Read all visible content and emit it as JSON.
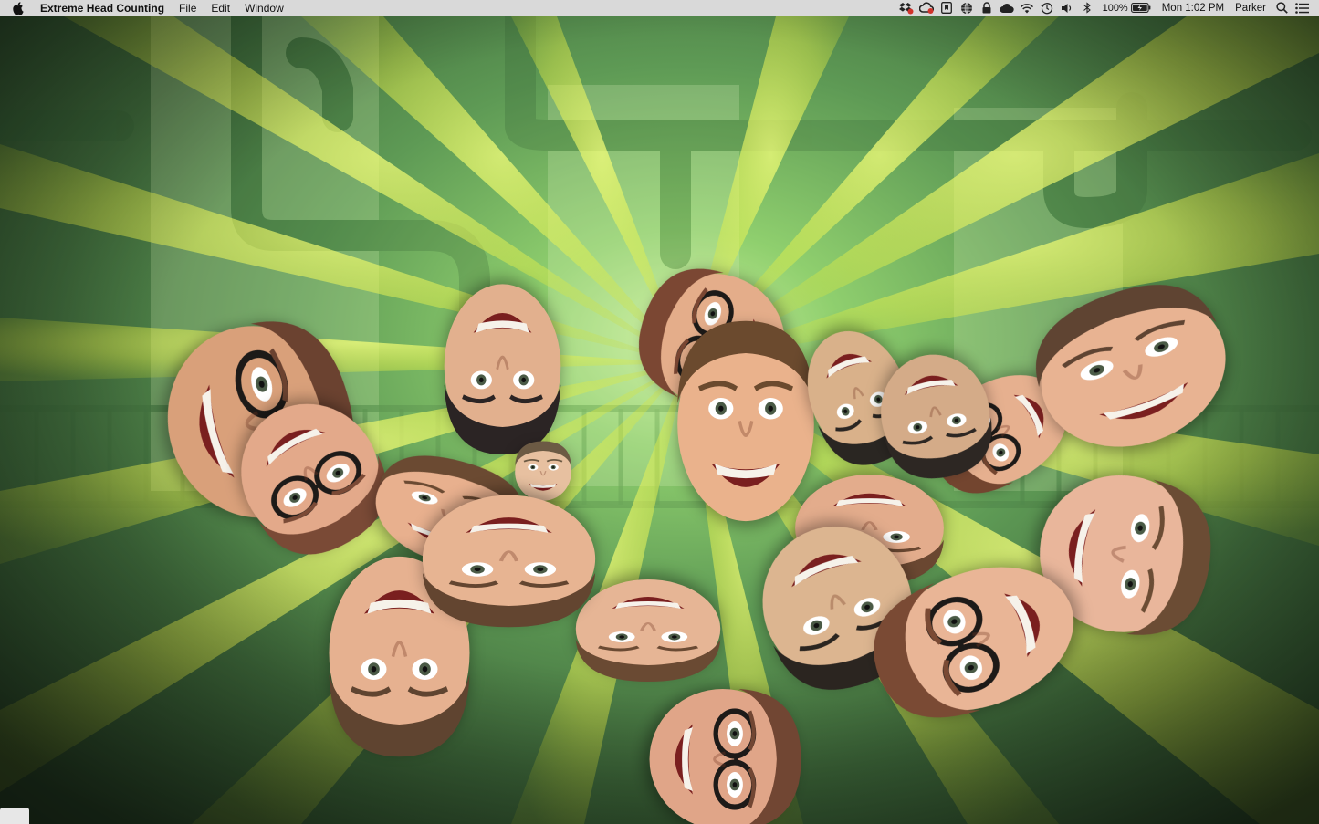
{
  "menubar": {
    "app_name": "Extreme Head Counting",
    "menus": [
      "File",
      "Edit",
      "Window"
    ],
    "status": {
      "battery_percent": "100%",
      "clock": "Mon 1:02 PM",
      "user": "Parker"
    },
    "status_icons": [
      "dropbox-icon",
      "creative-cloud-icon",
      "bookmark-app-icon",
      "globe-icon",
      "lock-icon",
      "cloud-icon",
      "wifi-icon",
      "time-machine-icon",
      "volume-icon",
      "bluetooth-icon",
      "battery-icon",
      "spotlight-search-icon",
      "notification-center-icon"
    ]
  },
  "game": {
    "heads": [
      {
        "id": "head-1",
        "type": "glasses",
        "tone": "#d9a07a",
        "hair": "#6b4230",
        "rotation": 75
      },
      {
        "id": "head-2",
        "type": "smile",
        "tone": "#e2b08e",
        "hair": "#2b2424",
        "rotation": 180
      },
      {
        "id": "head-3",
        "type": "glasses",
        "tone": "#e3a98a",
        "hair": "#7a4a36",
        "rotation": 150
      },
      {
        "id": "head-4",
        "type": "smile",
        "tone": "#e7c0a0",
        "hair": "#6c5a44",
        "rotation": 0
      },
      {
        "id": "head-5",
        "type": "glasses",
        "tone": "#e4ad8a",
        "hair": "#7b4733",
        "rotation": -70
      },
      {
        "id": "head-6",
        "type": "smile",
        "tone": "#eab28c",
        "hair": "#6b4a2e",
        "rotation": 0
      },
      {
        "id": "head-7",
        "type": "smile",
        "tone": "#d9b18a",
        "hair": "#2a2622",
        "rotation": 160
      },
      {
        "id": "head-8",
        "type": "smile",
        "tone": "#d4ab88",
        "hair": "#2d2723",
        "rotation": 170
      },
      {
        "id": "head-9",
        "type": "glasses",
        "tone": "#e6b08f",
        "hair": "#73452f",
        "rotation": -120
      },
      {
        "id": "head-10",
        "type": "smile",
        "tone": "#e8b392",
        "hair": "#5f4432",
        "rotation": -20
      },
      {
        "id": "head-11",
        "type": "smile",
        "tone": "#e9b69b",
        "hair": "#6b4c34",
        "rotation": 100
      },
      {
        "id": "head-12",
        "type": "smile",
        "tone": "#dcb590",
        "hair": "#2b2520",
        "rotation": 160
      },
      {
        "id": "head-13",
        "type": "glasses",
        "tone": "#e9b596",
        "hair": "#7a4a34",
        "rotation": -110
      },
      {
        "id": "head-14",
        "type": "smile",
        "tone": "#e3ac8c",
        "hair": "#6a4731",
        "rotation": 180
      },
      {
        "id": "head-15",
        "type": "smile",
        "tone": "#e8b08e",
        "hair": "#6b4a32",
        "rotation": 15
      },
      {
        "id": "head-16",
        "type": "smile",
        "tone": "#e7b492",
        "hair": "#634530",
        "rotation": 180
      },
      {
        "id": "head-17",
        "type": "smile",
        "tone": "#e6b190",
        "hair": "#5f4430",
        "rotation": 180
      },
      {
        "id": "head-18",
        "type": "smile",
        "tone": "#e6b595",
        "hair": "#6a4a33",
        "rotation": 180
      },
      {
        "id": "head-19",
        "type": "glasses",
        "tone": "#e0a588",
        "hair": "#714633",
        "rotation": 90
      }
    ]
  }
}
